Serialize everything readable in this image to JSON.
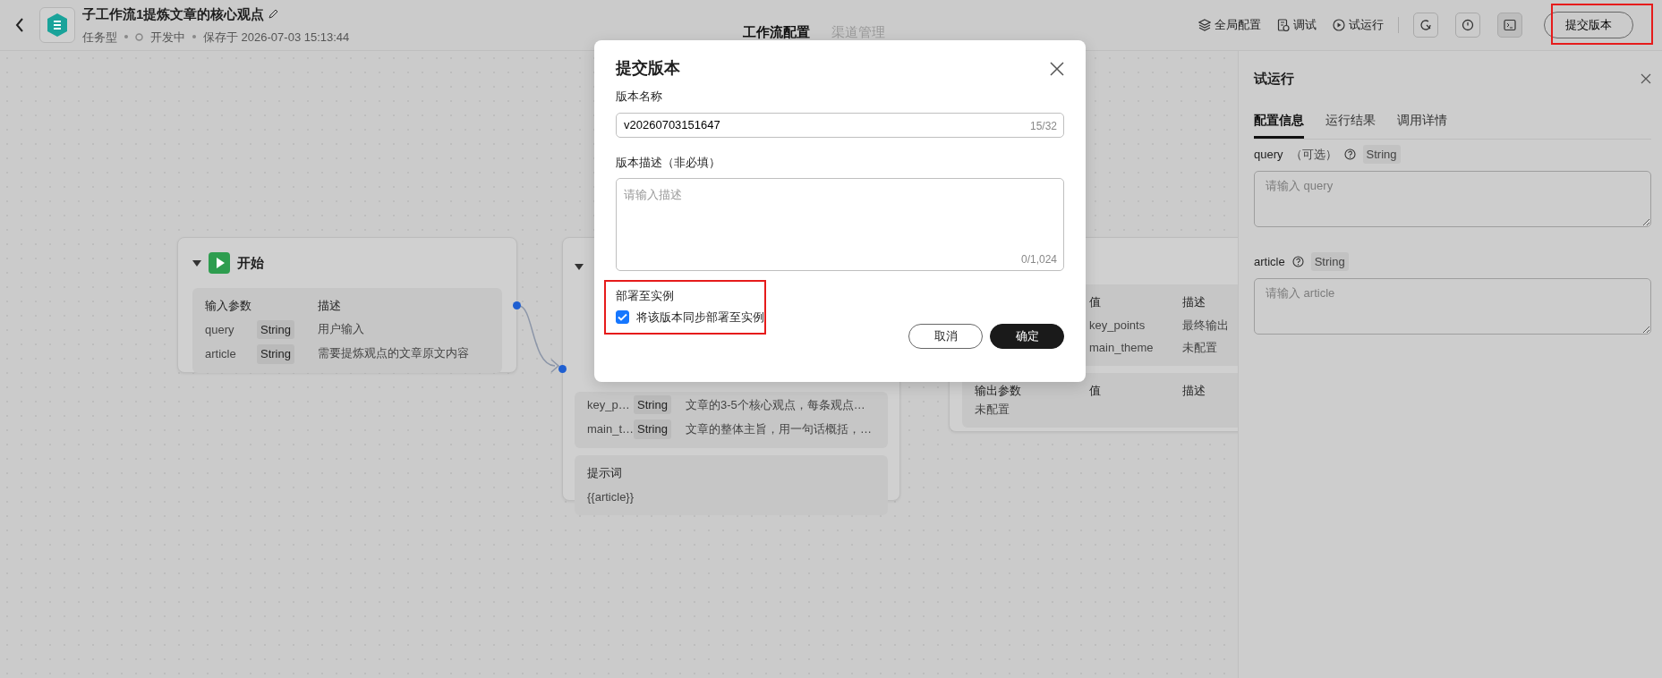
{
  "header": {
    "title": "子工作流1提炼文章的核心观点",
    "type": "任务型",
    "status": "开发中",
    "saved": "保存于 2026-07-03 15:13:44",
    "tabs": [
      {
        "label": "工作流配置",
        "selected": true
      },
      {
        "label": "渠道管理",
        "selected": false
      }
    ],
    "actions": [
      {
        "kind": "layers",
        "label": "全局配置"
      },
      {
        "kind": "debug",
        "label": "调试"
      },
      {
        "kind": "play",
        "label": "试运行"
      }
    ],
    "submit": "提交版本"
  },
  "nodes": [
    {
      "kind": "start",
      "title": "开始",
      "columns": [
        "输入参数",
        "描述"
      ],
      "rows": [
        {
          "name": "query",
          "type": "String",
          "desc": "用户输入"
        },
        {
          "name": "article",
          "type": "String",
          "desc": "需要提炼观点的文章原文内容"
        }
      ]
    },
    {
      "kind": "llm",
      "rows": [
        {
          "name": "key_p…",
          "type": "String",
          "desc": "文章的3-5个核心观点，每条观点…"
        },
        {
          "name": "main_t…",
          "type": "String",
          "desc": "文章的整体主旨，用一句话概括，…"
        }
      ],
      "prompt": {
        "label": "提示词",
        "value": "{{article}}"
      }
    },
    {
      "kind": "end",
      "columns": [
        "值",
        "描述"
      ],
      "rows": [
        {
          "value": "key_points",
          "desc": "最终输出"
        },
        {
          "value": "main_theme",
          "desc": "未配置"
        }
      ],
      "output": {
        "columns": [
          "输出参数",
          "值",
          "描述"
        ],
        "empty": "未配置"
      }
    }
  ],
  "dialog": {
    "title": "提交版本",
    "name_label": "版本名称",
    "name_value": "v20260703151647",
    "name_count": "15/32",
    "desc_label": "版本描述（非必填）",
    "desc_placeholder": "请输入描述",
    "desc_count": "0/1,024",
    "deploy_label": "部署至实例",
    "deploy_option": "将该版本同步部署至实例",
    "deploy_checked": true,
    "buttons": [
      {
        "kind": "secondary",
        "label": "取消"
      },
      {
        "kind": "primary",
        "label": "确定"
      }
    ]
  },
  "panel": {
    "title": "试运行",
    "tabs": [
      {
        "label": "配置信息",
        "selected": true
      },
      {
        "label": "运行结果",
        "selected": false
      },
      {
        "label": "调用详情",
        "selected": false
      }
    ],
    "params": [
      {
        "name": "query",
        "optional": "（可选）",
        "type": "String",
        "placeholder": "请输入 query"
      },
      {
        "name": "article",
        "type": "String",
        "placeholder": "请输入 article"
      }
    ]
  }
}
